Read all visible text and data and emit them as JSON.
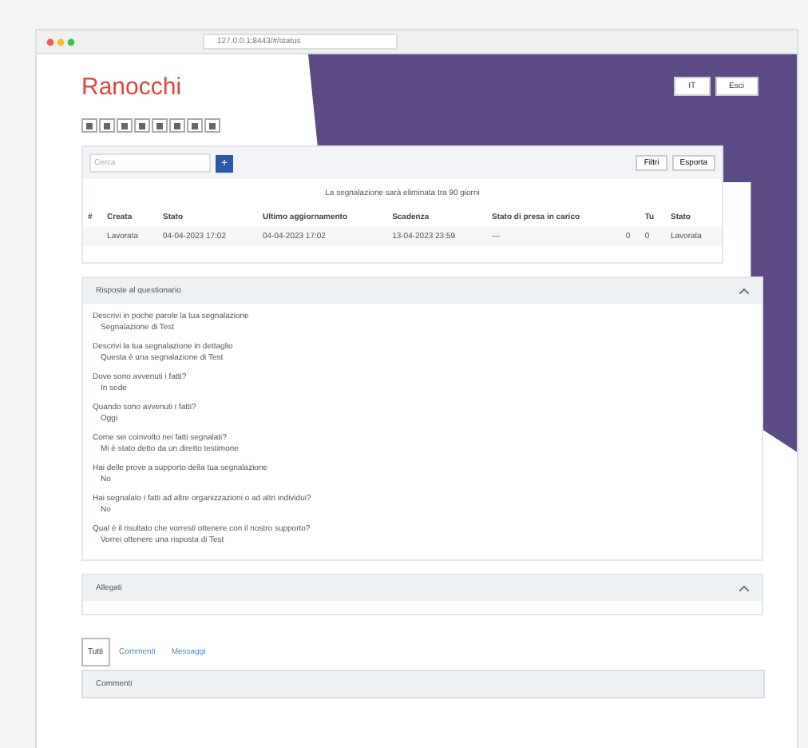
{
  "browser": {
    "url": "127.0.0.1:8443/#/status"
  },
  "header": {
    "logo": "Ranocchi",
    "actions": [
      {
        "label": "IT"
      },
      {
        "label": "Esci"
      }
    ]
  },
  "search": {
    "placeholder": "Cerca",
    "add": "+",
    "buttons": [
      "Filtri",
      "Esporta"
    ]
  },
  "notice": "La segnalazione sarà eliminata tra 90 giorni",
  "table": {
    "columns": [
      "#",
      "Creata",
      "Stato",
      "Ultimo aggiornamento",
      "Scadenza",
      "Stato di presa in carico",
      "",
      "Tu",
      "Stato"
    ],
    "rows": [
      [
        "",
        "Lavorata",
        "04-04-2023 17:02",
        "04-04-2023 17:02",
        "13-04-2023 23:59",
        "—",
        "0",
        "0",
        "Lavorata"
      ]
    ]
  },
  "sections": [
    {
      "title": "Risposte al questionario",
      "expanded": true,
      "items": [
        {
          "q": "Descrivi in poche parole la tua segnalazione",
          "a": "Segnalazione di Test"
        },
        {
          "q": "Descrivi la tua segnalazione in dettaglio",
          "a": "Questa è una segnalazione di Test"
        },
        {
          "q": "Dove sono avvenuti i fatti?",
          "a": "In sede"
        },
        {
          "q": "Quando sono avvenuti i fatti?",
          "a": "Oggi"
        },
        {
          "q": "Come sei coinvolto nei fatti segnalati?",
          "a": "Mi è stato detto da un diretto testimone"
        },
        {
          "q": "Hai delle prove a supporto della tua segnalazione",
          "a": "No"
        },
        {
          "q": "Hai segnalato i fatti ad altre organizzazioni o ad altri individui?",
          "a": "No"
        },
        {
          "q": "Qual è il risultato che vorresti ottenere con il nostro supporto?",
          "a": "Vorrei ottenere una risposta di Test"
        }
      ]
    },
    {
      "title": "Allegati",
      "expanded": true
    }
  ],
  "tabs": [
    {
      "label": "Tutti",
      "selected": true
    },
    {
      "label": "Commenti",
      "selected": false
    },
    {
      "label": "Messaggi",
      "selected": false
    }
  ],
  "bottom_panel": {
    "title": "Commenti"
  }
}
